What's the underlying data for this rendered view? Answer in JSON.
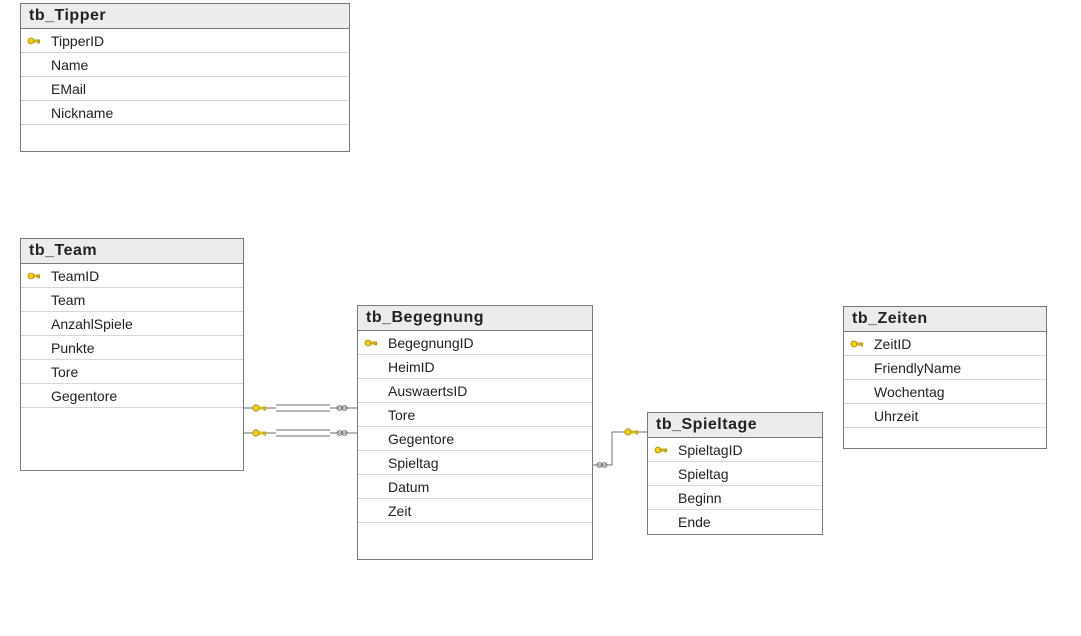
{
  "tables": {
    "tipper": {
      "title": "tb_Tipper",
      "columns": [
        {
          "name": "TipperID",
          "pk": true
        },
        {
          "name": "Name",
          "pk": false
        },
        {
          "name": "EMail",
          "pk": false
        },
        {
          "name": "Nickname",
          "pk": false
        }
      ]
    },
    "team": {
      "title": "tb_Team",
      "columns": [
        {
          "name": "TeamID",
          "pk": true
        },
        {
          "name": "Team",
          "pk": false
        },
        {
          "name": "AnzahlSpiele",
          "pk": false
        },
        {
          "name": "Punkte",
          "pk": false
        },
        {
          "name": "Tore",
          "pk": false
        },
        {
          "name": "Gegentore",
          "pk": false
        }
      ]
    },
    "begegnung": {
      "title": "tb_Begegnung",
      "columns": [
        {
          "name": "BegegnungID",
          "pk": true
        },
        {
          "name": "HeimID",
          "pk": false
        },
        {
          "name": "AuswaertsID",
          "pk": false
        },
        {
          "name": "Tore",
          "pk": false
        },
        {
          "name": "Gegentore",
          "pk": false
        },
        {
          "name": "Spieltag",
          "pk": false
        },
        {
          "name": "Datum",
          "pk": false
        },
        {
          "name": "Zeit",
          "pk": false
        }
      ]
    },
    "spieltage": {
      "title": "tb_Spieltage",
      "columns": [
        {
          "name": "SpieltagID",
          "pk": true
        },
        {
          "name": "Spieltag",
          "pk": false
        },
        {
          "name": "Beginn",
          "pk": false
        },
        {
          "name": "Ende",
          "pk": false
        }
      ]
    },
    "zeiten": {
      "title": "tb_Zeiten",
      "columns": [
        {
          "name": "ZeitID",
          "pk": true
        },
        {
          "name": "FriendlyName",
          "pk": false
        },
        {
          "name": "Wochentag",
          "pk": false
        },
        {
          "name": "Uhrzeit",
          "pk": false
        }
      ]
    }
  },
  "relationships": [
    {
      "from_table": "tb_Team",
      "from_side": "one",
      "to_table": "tb_Begegnung",
      "to_side": "many",
      "fk": "HeimID"
    },
    {
      "from_table": "tb_Team",
      "from_side": "one",
      "to_table": "tb_Begegnung",
      "to_side": "many",
      "fk": "AuswaertsID"
    },
    {
      "from_table": "tb_Spieltage",
      "from_side": "one",
      "to_table": "tb_Begegnung",
      "to_side": "many",
      "fk": "Spieltag"
    }
  ],
  "icons": {
    "primary_key": "key-icon",
    "many_end": "infinity-icon"
  }
}
